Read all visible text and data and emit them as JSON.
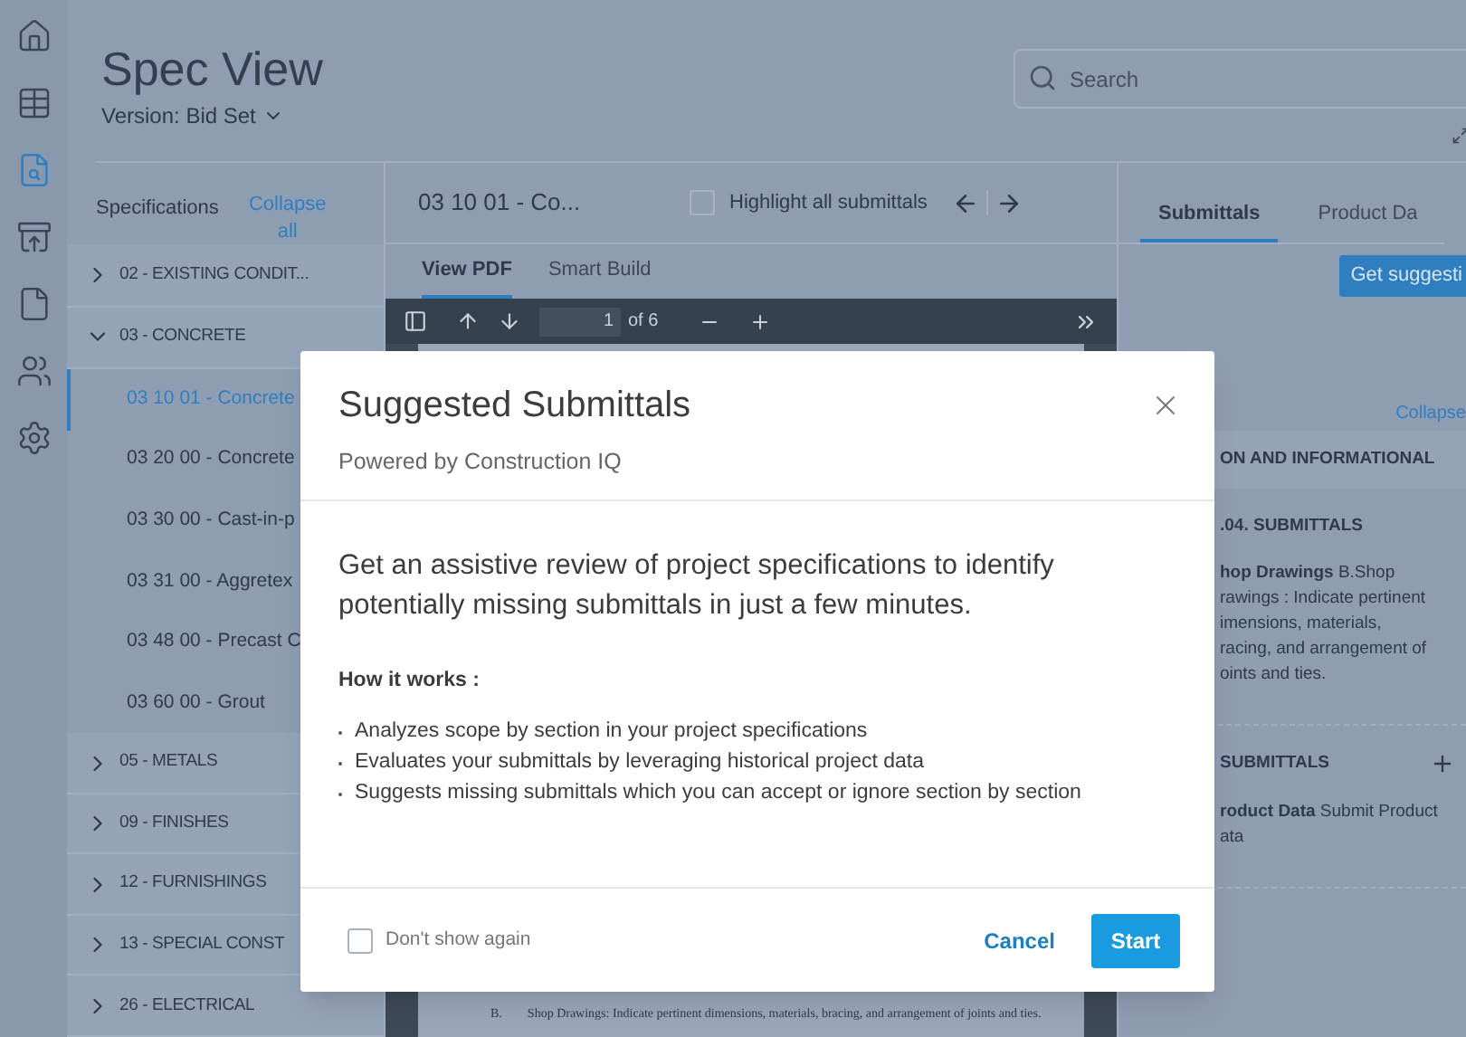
{
  "rail": [
    {
      "selected": false
    },
    {
      "selected": false
    },
    {
      "selected": true
    },
    {
      "selected": false
    },
    {
      "selected": false
    },
    {
      "selected": false
    },
    {
      "selected": false
    }
  ],
  "header": {
    "title": "Spec View",
    "version": "Version: Bid Set",
    "search": {
      "placeholder": "Search"
    }
  },
  "specifications": {
    "label": "Specifications",
    "collapse": "Collapse all",
    "tree": [
      {
        "label": "02 - EXISTING CONDIT...",
        "expanded": false
      },
      {
        "label": "03 - CONCRETE",
        "expanded": true,
        "children": [
          {
            "label": "03 10 01 - Concrete",
            "selected": true
          },
          {
            "label": "03 20 00 - Concrete",
            "selected": false
          },
          {
            "label": "03 30 00 - Cast-in-p",
            "selected": false
          },
          {
            "label": "03 31 00 - Aggretex",
            "selected": false
          },
          {
            "label": "03 48 00 - Precast C",
            "selected": false
          },
          {
            "label": "03 60 00 - Grout",
            "selected": false
          }
        ]
      },
      {
        "label": "05 - METALS",
        "expanded": false
      },
      {
        "label": "09 - FINISHES",
        "expanded": false
      },
      {
        "label": "12 - FURNISHINGS",
        "expanded": false
      },
      {
        "label": "13 - SPECIAL CONST",
        "expanded": false
      },
      {
        "label": "26 - ELECTRICAL",
        "expanded": false
      }
    ]
  },
  "document": {
    "title": "03 10 01 - Co...",
    "highlight": {
      "label": "Highlight all submittals",
      "checked": false
    },
    "tabs": [
      {
        "label": "View PDF",
        "selected": true
      },
      {
        "label": "Smart Build",
        "selected": false
      }
    ],
    "pdf_toolbar": {
      "page": "1",
      "of": "of 6"
    },
    "pdf_text": {
      "marker": "B.",
      "text": "Shop Drawings: Indicate pertinent dimensions, materials, bracing, and arrangement of joints and ties."
    }
  },
  "side_panel": {
    "tabs": [
      {
        "label": "Submittals",
        "selected": true
      },
      {
        "label": "Product Da",
        "selected": false
      }
    ],
    "button": "Get suggesti",
    "collapse": "Collapse",
    "section": "ON AND INFORMATIONAL",
    "cards": [
      {
        "title": ".04. SUBMITTALS",
        "lines": [
          "**hop Drawings** B.Shop",
          "rawings : Indicate pertinent",
          "imensions, materials,",
          "racing, and arrangement of",
          "oints and ties."
        ],
        "add": false
      },
      {
        "title": "SUBMITTALS",
        "lines": [
          "**roduct Data** Submit Product",
          "ata"
        ],
        "add": true
      }
    ]
  },
  "modal": {
    "title": "Suggested Submittals",
    "subtitle": "Powered by Construction IQ",
    "intro": "Get an assistive review of project specifications to identify potentially missing submittals in just a few minutes.",
    "how_title": "How it works :",
    "bullets": [
      "Analyzes scope by section in your project specifications",
      "Evaluates your submittals by leveraging historical project data",
      "Suggests missing submittals which you can accept or ignore section by section"
    ],
    "dont_show": {
      "label": "Don't show again",
      "checked": false
    },
    "cancel": "Cancel",
    "start": "Start"
  }
}
